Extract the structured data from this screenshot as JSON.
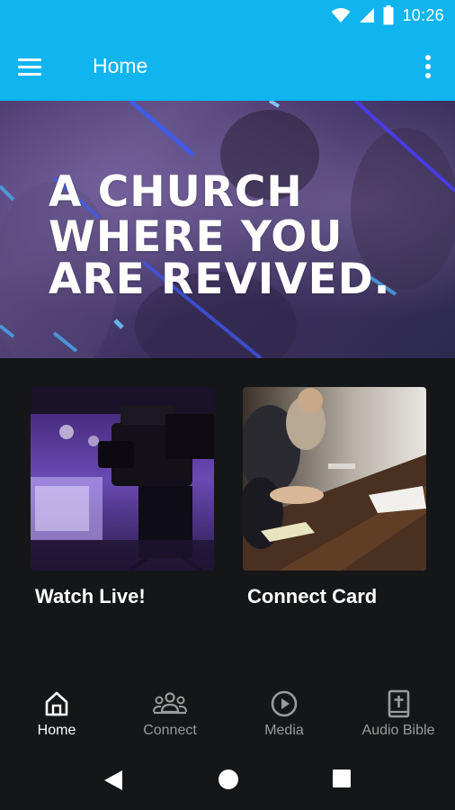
{
  "status_bar": {
    "time": "10:26"
  },
  "app_bar": {
    "title": "Home"
  },
  "hero": {
    "lines": [
      "A CHURCH",
      "WHERE YOU",
      "ARE REVIVED."
    ]
  },
  "cards": [
    {
      "label": "Watch Live!"
    },
    {
      "label": "Connect Card"
    }
  ],
  "bottom_nav": {
    "items": [
      {
        "label": "Home",
        "icon": "home-icon",
        "active": true
      },
      {
        "label": "Connect",
        "icon": "people-icon",
        "active": false
      },
      {
        "label": "Media",
        "icon": "play-circle-icon",
        "active": false
      },
      {
        "label": "Audio Bible",
        "icon": "bible-icon",
        "active": false
      }
    ]
  },
  "colors": {
    "accent": "#10b4ee",
    "background": "#151617",
    "inactive": "#9a9a9a"
  }
}
